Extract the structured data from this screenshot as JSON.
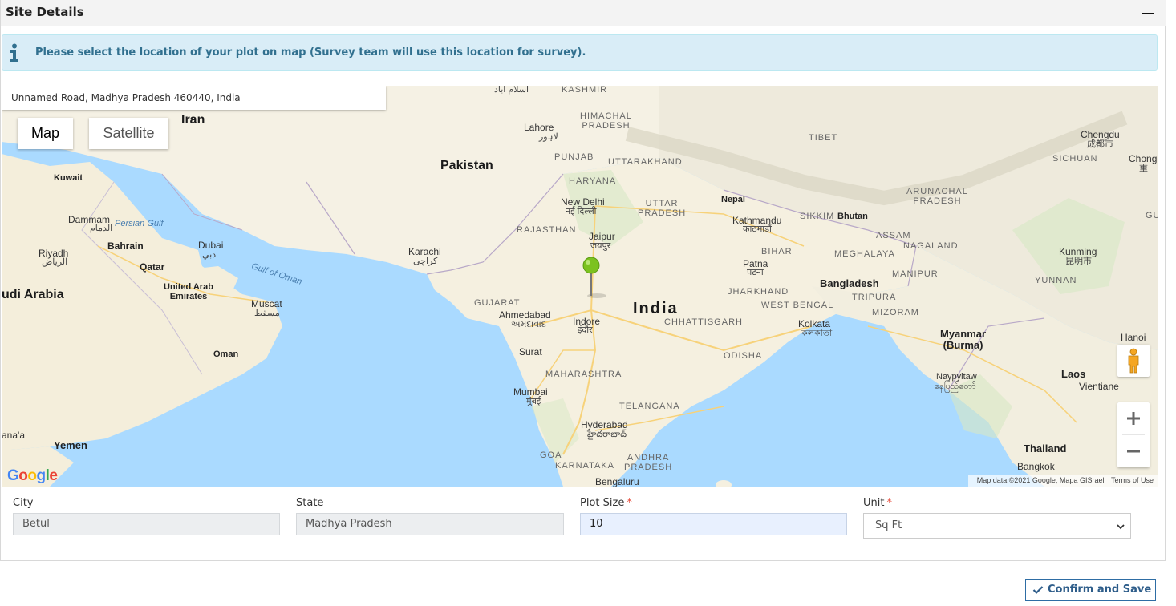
{
  "panel": {
    "title": "Site Details",
    "collapse_icon": "minus-icon"
  },
  "alert": {
    "icon": "info-icon",
    "text": "Please select the location of your plot on map (Survey team will use this location for survey)."
  },
  "map": {
    "address": "Unnamed Road, Madhya Pradesh 460440, India",
    "map_type_buttons": [
      "Map",
      "Satellite"
    ],
    "selected_map_type": "Map",
    "marker_icon": "green-pin-icon",
    "labels": {
      "iran": "Iran",
      "pakistan": "Pakistan",
      "india": "India",
      "kuwait": "Kuwait",
      "dammam": "Dammam",
      "dammam_ar": "الدمام",
      "persian_gulf": "Persian Gulf",
      "bahrain": "Bahrain",
      "riyadh": "Riyadh",
      "riyadh_ar": "الرياض",
      "qatar": "Qatar",
      "dubai": "Dubai",
      "dubai_ar": "دبي",
      "uae": "United Arab\nEmirates",
      "saudi": "udi Arabia",
      "gulf_oman": "Gulf of Oman",
      "muscat": "Muscat",
      "muscat_ar": "مسقط",
      "oman": "Oman",
      "sanaa": "ana'a",
      "yemen": "Yemen",
      "karachi": "Karachi",
      "karachi_ur": "کراچی",
      "lahore": "Lahore",
      "lahore_ur": "لاہور",
      "islamabad": "اسلام آباد",
      "kashmir": "KASHMIR",
      "himachal": "HIMACHAL\nPRADESH",
      "punjab": "PUNJAB",
      "uttarakhand": "UTTARAKHAND",
      "haryana": "HARYANA",
      "new_delhi": "New Delhi",
      "new_delhi_hi": "नई दिल्ली",
      "rajasthan": "RAJASTHAN",
      "jaipur": "Jaipur",
      "jaipur_hi": "जयपुर",
      "uttar_pradesh": "UTTAR\nPRADESH",
      "nepal": "Nepal",
      "kathmandu": "Kathmandu",
      "kathmandu_ne": "काठमाडौं",
      "sikkim": "SIKKIM",
      "bhutan": "Bhutan",
      "tibet": "TIBET",
      "arunachal": "ARUNACHAL\nPRADESH",
      "assam": "ASSAM",
      "nagaland": "NAGALAND",
      "meghalaya": "MEGHALAYA",
      "bihar": "BIHAR",
      "patna": "Patna",
      "patna_hi": "पटना",
      "bangladesh": "Bangladesh",
      "manipur": "MANIPUR",
      "jharkhand": "JHARKHAND",
      "tripura": "TRIPURA",
      "west_bengal": "WEST BENGAL",
      "mizoram": "MIZORAM",
      "kolkata": "Kolkata",
      "kolkata_bn": "কলকাতা",
      "chhattisgarh": "CHHATTISGARH",
      "gujarat": "GUJARAT",
      "ahmedabad": "Ahmedabad",
      "ahmedabad_gu": "અમદાવાદ",
      "indore": "Indore",
      "indore_hi": "इंदौर",
      "surat": "Surat",
      "odisha": "ODISHA",
      "maharashtra": "MAHARASHTRA",
      "mumbai": "Mumbai",
      "mumbai_mr": "मुंबई",
      "telangana": "TELANGANA",
      "hyderabad": "Hyderabad",
      "hyderabad_te": "హైదరాబాద్",
      "goa": "GOA",
      "karnataka": "KARNATAKA",
      "andhra": "ANDHRA\nPRADESH",
      "bengaluru": "Bengaluru",
      "myanmar": "Myanmar\n(Burma)",
      "naypyitaw": "Naypyitaw",
      "naypyitaw_my": "နေပြည်တော်",
      "laos": "Laos",
      "vientiane": "Vientiane",
      "thailand": "Thailand",
      "bangkok": "Bangkok",
      "hanoi": "Hanoi",
      "chengdu": "Chengdu",
      "chengdu_zh": "成都市",
      "sichuan": "SICHUAN",
      "chong": "Chong",
      "chong_zh": "重",
      "kunming": "Kunming",
      "kunming_zh": "昆明市",
      "yunnan": "YUNNAN",
      "gu": "GU"
    },
    "attribution": "Map data ©2021 Google, Mapa GISrael",
    "terms": "Terms of Use",
    "google_logo": "Google",
    "pegman_icon": "pegman-icon",
    "zoom_in_icon": "plus-icon",
    "zoom_out_icon": "minus-icon"
  },
  "form": {
    "city": {
      "label": "City",
      "value": "Betul"
    },
    "state": {
      "label": "State",
      "value": "Madhya Pradesh"
    },
    "plot_size": {
      "label": "Plot Size",
      "required": "*",
      "value": "10"
    },
    "unit": {
      "label": "Unit",
      "required": "*",
      "value": "Sq Ft"
    }
  },
  "actions": {
    "confirm_label": "Confirm and Save",
    "confirm_icon": "check-icon"
  },
  "colors": {
    "alert_bg": "#d9edf7",
    "alert_text": "#31708f",
    "map_water": "#aadaff",
    "map_land": "#f5f1e6",
    "marker": "#7cc21f",
    "button_border": "#2e6da4"
  }
}
